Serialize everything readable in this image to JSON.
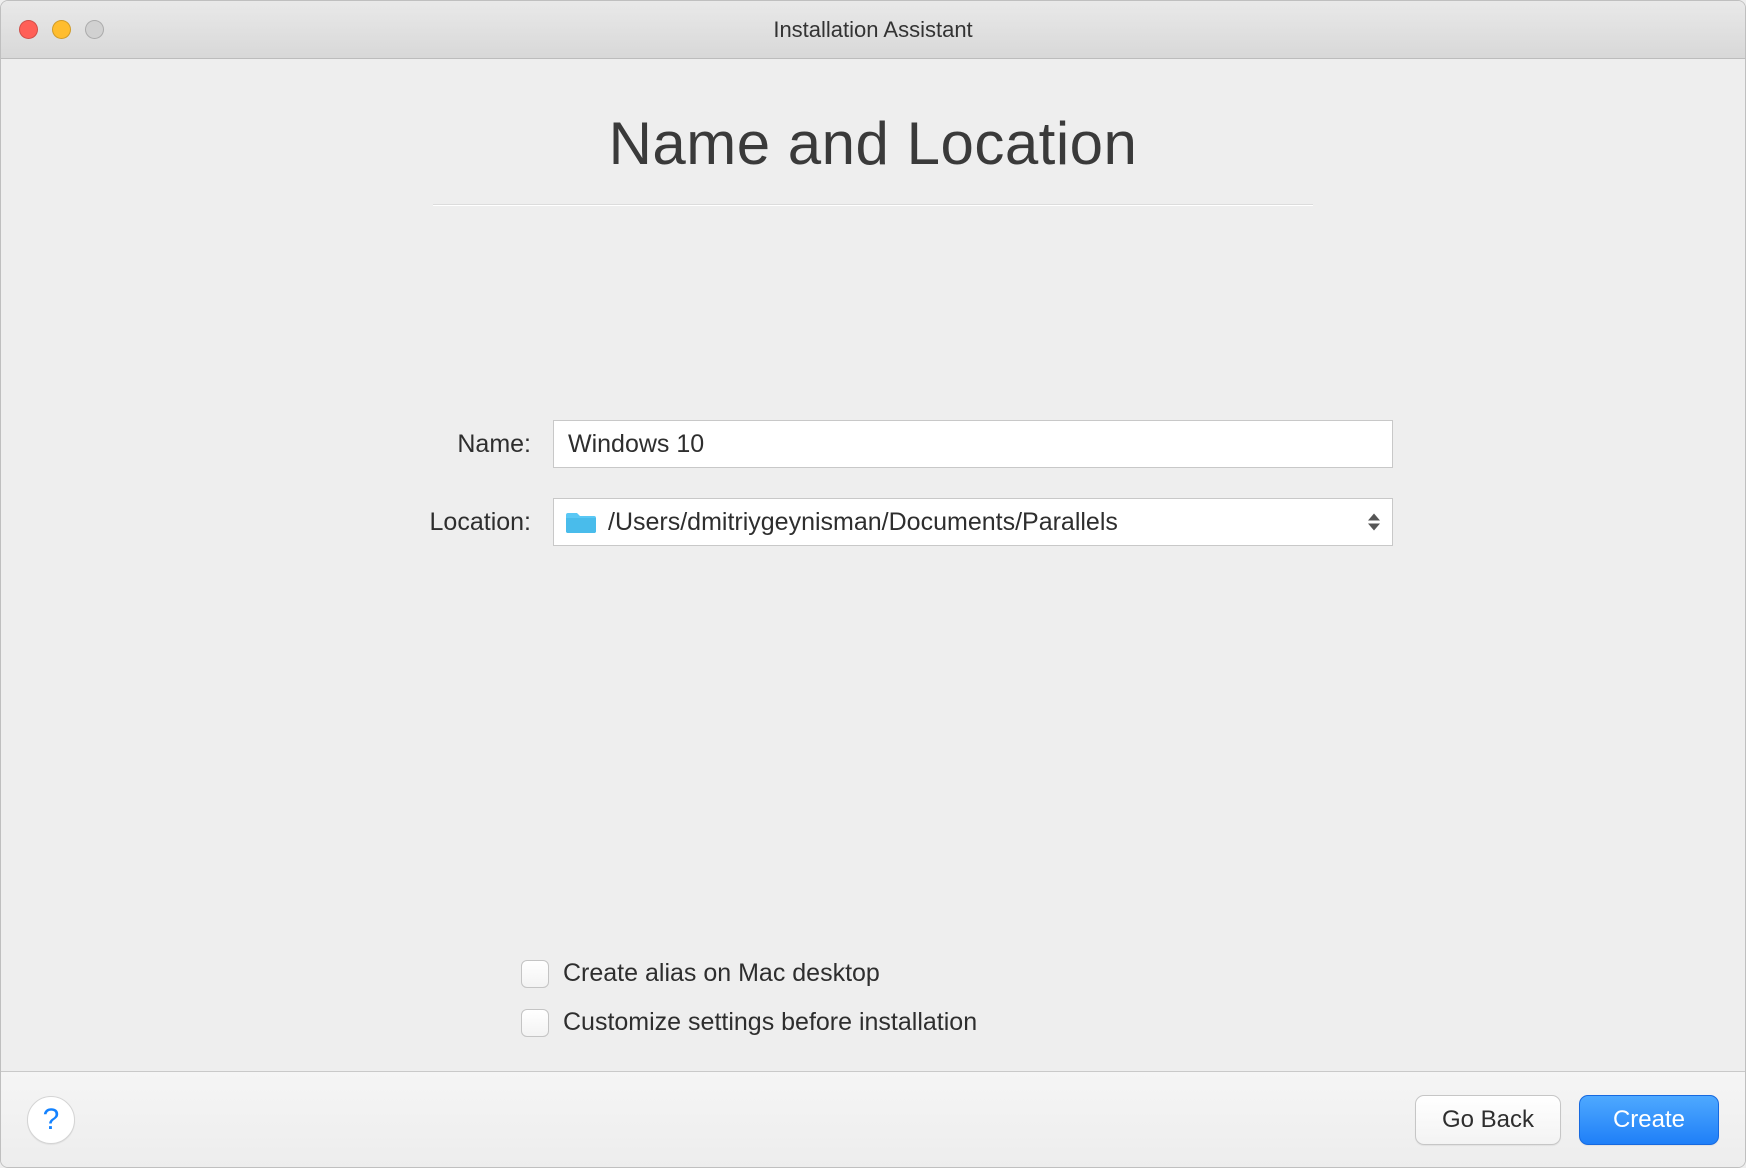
{
  "window": {
    "title": "Installation Assistant"
  },
  "heading": "Name and Location",
  "form": {
    "name_label": "Name:",
    "name_value": "Windows 10",
    "location_label": "Location:",
    "location_value": "/Users/dmitriygeynisman/Documents/Parallels"
  },
  "options": {
    "alias_label": "Create alias on Mac desktop",
    "customize_label": "Customize settings before installation"
  },
  "footer": {
    "help": "?",
    "back": "Go Back",
    "create": "Create"
  }
}
